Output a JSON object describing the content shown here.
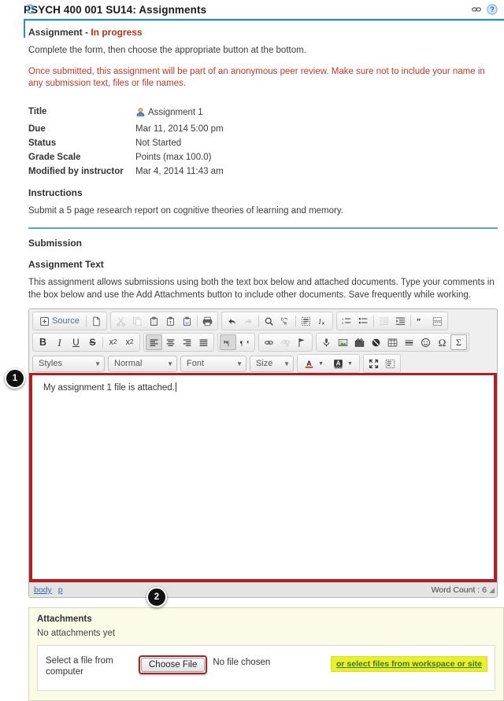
{
  "header": {
    "title": "PSYCH 400 001 SU14: Assignments",
    "refresh_icon": "refresh-icon",
    "link_icon": "permalink-icon",
    "help_icon": "help-icon"
  },
  "assignment": {
    "label": "Assignment - ",
    "status_word": "In progress",
    "instruction_line": "Complete the form, then choose the appropriate button at the bottom.",
    "warning_line": "Once submitted, this assignment will be part of an anonymous peer review. Make sure not to include your name in any submission text, files or file names."
  },
  "details": [
    {
      "key": "Title",
      "value": "Assignment 1",
      "icon": "assignment-person-icon"
    },
    {
      "key": "Due",
      "value": "Mar 11, 2014 5:00 pm"
    },
    {
      "key": "Status",
      "value": "Not Started"
    },
    {
      "key": "Grade Scale",
      "value": "Points (max 100.0)"
    },
    {
      "key": "Modified by instructor",
      "value": "Mar 4, 2014 11:43 am"
    }
  ],
  "instructions": {
    "heading": "Instructions",
    "body": "Submit a 5 page research report on cognitive theories of learning and memory."
  },
  "submission": {
    "heading": "Submission",
    "assignment_text_heading": "Assignment Text",
    "help_text": "This assignment allows submissions using both the text box below and attached documents. Type your comments in the box below and use the Add Attachments button to include other documents. Save frequently while working."
  },
  "editor": {
    "source_label": "Source",
    "row1": [
      {
        "name": "source-button",
        "glyph": "▤",
        "label": "Source"
      },
      {
        "name": "new-page-button",
        "glyph": "὜B"
      },
      {
        "name": "cut-button",
        "glyph": "✂",
        "disabled": true
      },
      {
        "name": "copy-button",
        "glyph": "⧉",
        "disabled": true
      },
      {
        "name": "paste-button",
        "glyph": "ὌB"
      },
      {
        "name": "paste-as-text-button",
        "glyph": "T"
      },
      {
        "name": "paste-from-word-button",
        "glyph": "W"
      },
      {
        "name": "print-button",
        "glyph": "⎙"
      },
      {
        "name": "undo-button",
        "glyph": "↶"
      },
      {
        "name": "redo-button",
        "glyph": "↷",
        "disabled": true
      },
      {
        "name": "find-button",
        "glyph": "ὐD"
      },
      {
        "name": "replace-button",
        "glyph": "ab"
      },
      {
        "name": "select-all-button",
        "glyph": "☰"
      },
      {
        "name": "remove-format-button",
        "glyph": "Ix"
      },
      {
        "name": "numbered-list-button",
        "glyph": "1."
      },
      {
        "name": "bulleted-list-button",
        "glyph": "•"
      },
      {
        "name": "decrease-indent-button",
        "glyph": "⇤",
        "disabled": true
      },
      {
        "name": "increase-indent-button",
        "glyph": "⇥"
      },
      {
        "name": "blockquote-button",
        "glyph": "”"
      },
      {
        "name": "div-container-button",
        "glyph": "⌸"
      }
    ],
    "row2": [
      {
        "name": "bold-button",
        "glyph": "B"
      },
      {
        "name": "italic-button",
        "glyph": "I"
      },
      {
        "name": "underline-button",
        "glyph": "U"
      },
      {
        "name": "strikethrough-button",
        "glyph": "S"
      },
      {
        "name": "subscript-button",
        "glyph": "x₂"
      },
      {
        "name": "superscript-button",
        "glyph": "x²"
      },
      {
        "name": "align-left-button",
        "glyph": "≡",
        "active": true
      },
      {
        "name": "align-center-button",
        "glyph": "≡"
      },
      {
        "name": "align-right-button",
        "glyph": "≡"
      },
      {
        "name": "align-justify-button",
        "glyph": "≡"
      },
      {
        "name": "ltr-button",
        "glyph": "¶",
        "active": true
      },
      {
        "name": "rtl-button",
        "glyph": "¶"
      },
      {
        "name": "link-button",
        "glyph": "ὑ7"
      },
      {
        "name": "unlink-button",
        "glyph": "ὑ7",
        "disabled": true
      },
      {
        "name": "anchor-button",
        "glyph": "⚑"
      },
      {
        "name": "insert-audio-button",
        "glyph": "Ἲ4"
      },
      {
        "name": "insert-image-button",
        "glyph": "ὛC"
      },
      {
        "name": "insert-movie-button",
        "glyph": "ἺC"
      },
      {
        "name": "insert-flash-button",
        "glyph": "⊘"
      },
      {
        "name": "insert-table-button",
        "glyph": "▦"
      },
      {
        "name": "horizontal-rule-button",
        "glyph": "═"
      },
      {
        "name": "smiley-button",
        "glyph": "☺"
      },
      {
        "name": "special-character-button",
        "glyph": "Ω"
      },
      {
        "name": "insert-formula-button",
        "glyph": "Σ"
      }
    ],
    "selects": [
      {
        "name": "styles-select",
        "value": "Styles"
      },
      {
        "name": "paragraph-format-select",
        "value": "Normal"
      },
      {
        "name": "font-select",
        "value": "Font"
      },
      {
        "name": "font-size-select",
        "value": "Size"
      }
    ],
    "color_buttons": [
      {
        "name": "text-color-button",
        "glyph": "A"
      },
      {
        "name": "background-color-button",
        "glyph": "A"
      }
    ],
    "extra_buttons": [
      {
        "name": "maximize-button",
        "glyph": "✥"
      },
      {
        "name": "show-blocks-button",
        "glyph": "⌸"
      }
    ],
    "text_value": "My assignment 1 file is attached.",
    "path": [
      "body",
      "p"
    ],
    "word_count_label": "Word Count : 6"
  },
  "attachments": {
    "heading": "Attachments",
    "empty_text": "No attachments yet",
    "select_label": "Select a file from computer",
    "choose_button": "Choose File",
    "no_file_text": "No file chosen",
    "workspace_link": "or select files from workspace or site"
  },
  "callouts": [
    {
      "id": "badge1",
      "number": "1"
    },
    {
      "id": "badge2",
      "number": "2"
    }
  ],
  "colors": {
    "accent_blue": "#2a8fbd",
    "warn_red": "#c0392b",
    "highlight_red": "#b01f24",
    "highlight_yellow": "#e9ef2a",
    "attachment_bg": "#fbfbe8"
  }
}
